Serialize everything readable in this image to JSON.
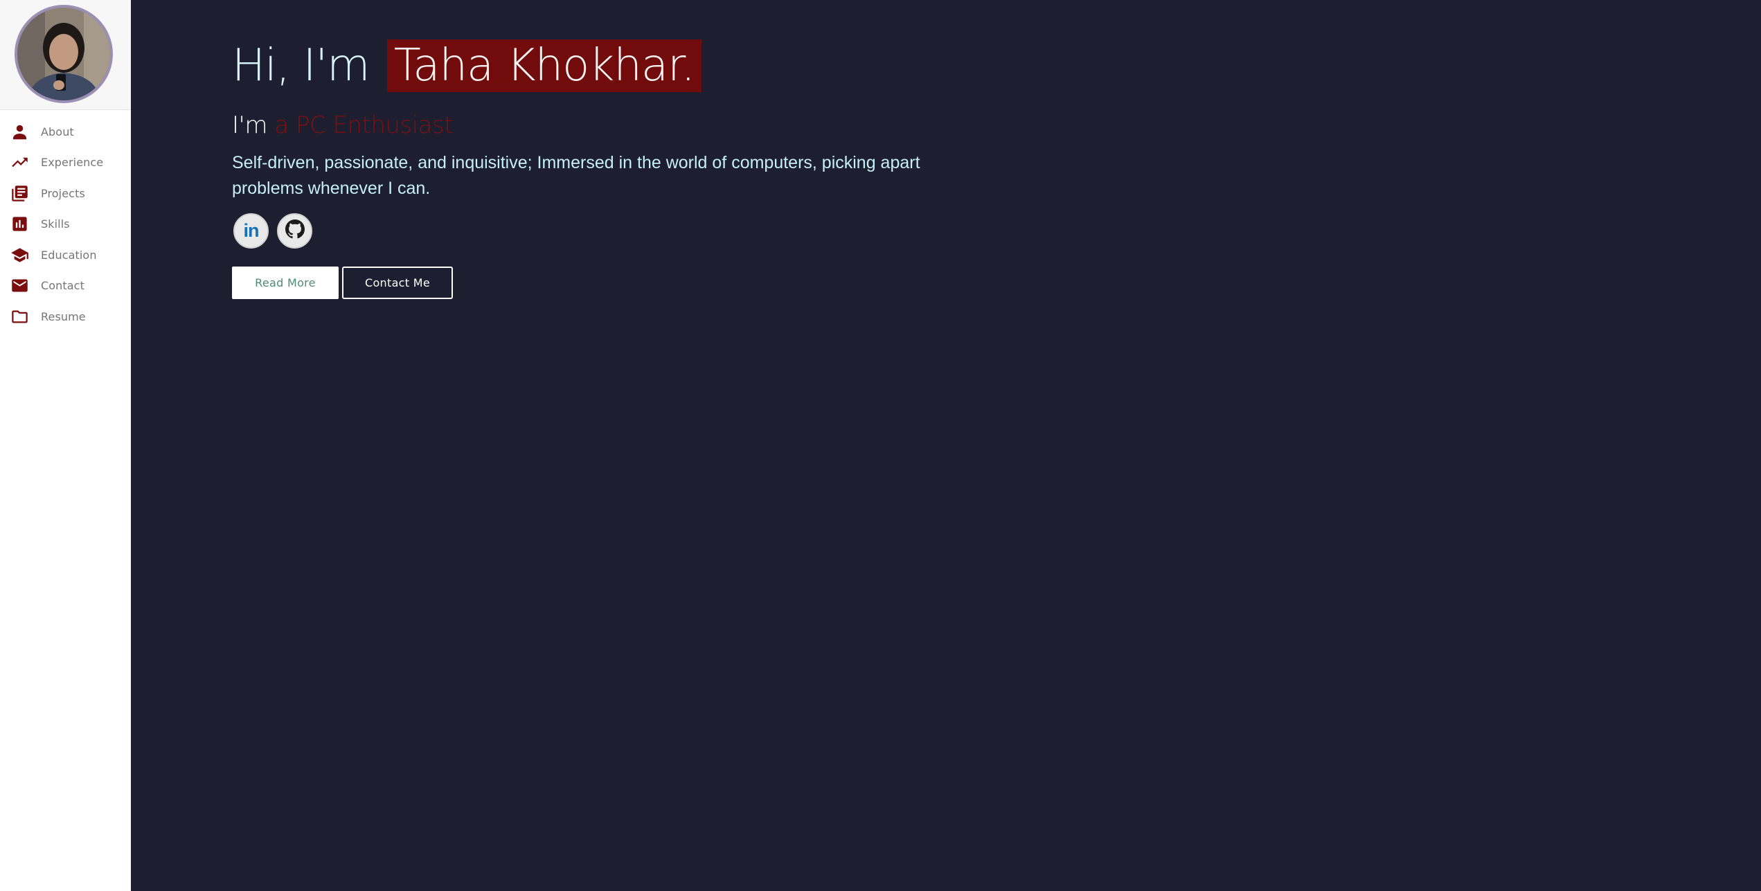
{
  "sidebar": {
    "avatar_alt": "Profile photo",
    "items": [
      {
        "label": "About",
        "icon": "person-icon"
      },
      {
        "label": "Experience",
        "icon": "trending-up-icon"
      },
      {
        "label": "Projects",
        "icon": "library-books-icon"
      },
      {
        "label": "Skills",
        "icon": "bar-chart-icon"
      },
      {
        "label": "Education",
        "icon": "school-icon"
      },
      {
        "label": "Contact",
        "icon": "email-icon"
      },
      {
        "label": "Resume",
        "icon": "folder-icon"
      }
    ]
  },
  "hero": {
    "greeting": "Hi, I'm",
    "name": "Taha Khokhar.",
    "tagline_prefix": "I'm",
    "tagline_role": "a PC Enthusiast",
    "bio": "Self-driven, passionate, and inquisitive; Immersed in the world of computers, picking apart problems whenever I can.",
    "social": {
      "linkedin_label": "in",
      "linkedin_icon": "linkedin-icon",
      "github_icon": "github-icon"
    },
    "buttons": {
      "read_more": "Read More",
      "contact_me": "Contact Me"
    }
  },
  "colors": {
    "background": "#1d1f30",
    "accent": "#720c0c",
    "sidebar_icon": "#7a0d0d",
    "headline_text": "#d8f3fb"
  }
}
